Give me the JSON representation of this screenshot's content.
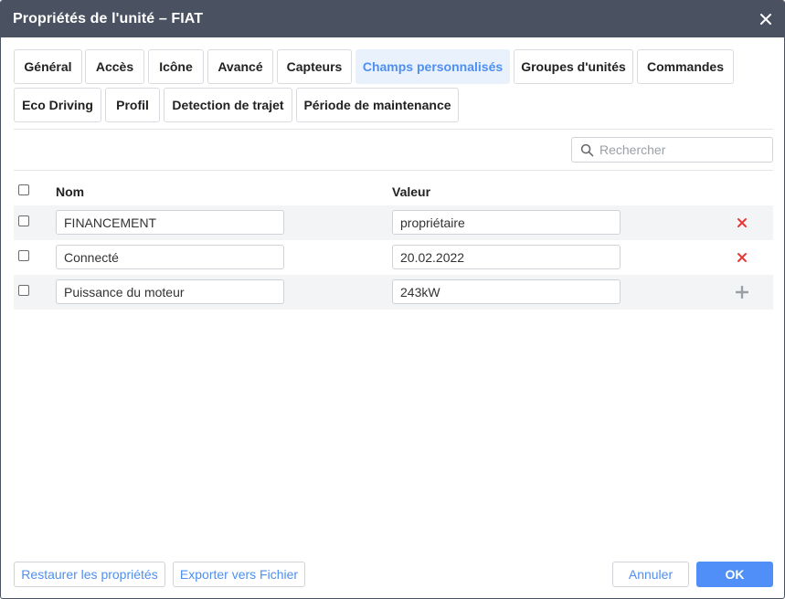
{
  "window": {
    "title": "Propriétés de l'unité – FIAT"
  },
  "tabs": [
    {
      "label": "Général",
      "active": false
    },
    {
      "label": "Accès",
      "active": false
    },
    {
      "label": "Icône",
      "active": false
    },
    {
      "label": "Avancé",
      "active": false
    },
    {
      "label": "Capteurs",
      "active": false
    },
    {
      "label": "Champs personnalisés",
      "active": true
    },
    {
      "label": "Groupes d'unités",
      "active": false
    },
    {
      "label": "Commandes",
      "active": false
    },
    {
      "label": "Eco Driving",
      "active": false
    },
    {
      "label": "Profil",
      "active": false
    },
    {
      "label": "Detection de trajet",
      "active": false
    },
    {
      "label": "Période de maintenance",
      "active": false
    }
  ],
  "search": {
    "placeholder": "Rechercher",
    "value": ""
  },
  "table": {
    "columns": {
      "name": "Nom",
      "value": "Valeur"
    },
    "rows": [
      {
        "name": "FINANCEMENT",
        "value": "propriétaire",
        "action": "delete"
      },
      {
        "name": "Connecté",
        "value": "20.02.2022",
        "action": "delete"
      },
      {
        "name": "Puissance du moteur",
        "value": "243kW",
        "action": "add"
      }
    ]
  },
  "footer": {
    "restore_label": "Restaurer les propriétés",
    "export_label": "Exporter vers Fichier",
    "cancel_label": "Annuler",
    "ok_label": "OK"
  },
  "colors": {
    "titlebar": "#4a5261",
    "accent": "#4f8ff0",
    "active_tab_bg": "#e9f1fd",
    "delete": "#e53935",
    "add": "#9aa0a6"
  },
  "icons": {
    "close": "close-icon",
    "search": "search-icon",
    "delete": "delete-icon",
    "add": "plus-icon"
  }
}
